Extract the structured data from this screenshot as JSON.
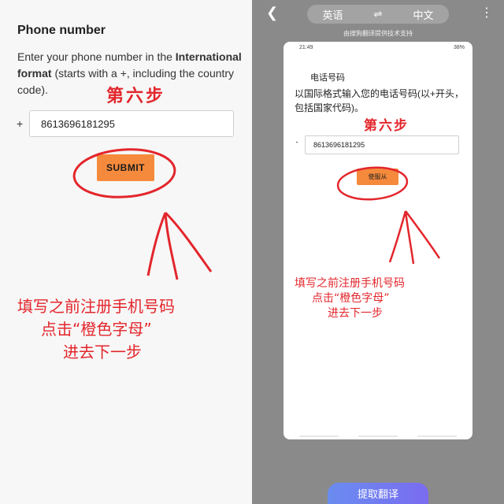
{
  "left": {
    "title": "Phone number",
    "desc_pre": "Enter your phone number in the ",
    "desc_bold": "International format",
    "desc_post": " (starts with a +, including the country code).",
    "plus": "+",
    "phone_value": "8613696181295",
    "submit_label": "SUBMIT",
    "step_annotation": "第六步",
    "note_lines": [
      "填写之前注册手机号码",
      "点击“橙色字母”",
      "进去下一步"
    ]
  },
  "right": {
    "lang_from": "英语",
    "swap_icon": "⇌",
    "lang_to": "中文",
    "powered_by": "由搜狗翻译提供技术支持",
    "status_time": "21:49",
    "status_right": "38%",
    "card_title": "电话号码",
    "card_desc": "以国际格式输入您的电话号码(以+开头，包括国家代码)。",
    "card_phone": "8613696181295",
    "card_submit": "使服从",
    "step_annotation": "第六步",
    "note_lines": [
      "填写之前注册手机号码",
      "点击“橙色字母”",
      "进去下一步"
    ],
    "translate_button": "提取翻译"
  },
  "colors": {
    "submit_orange": "#f68a3c",
    "annotation_red": "#e3262c",
    "right_bg": "#8a8a8a"
  },
  "icons": [
    "back-arrow-icon",
    "swap-icon",
    "more-dots-icon"
  ]
}
